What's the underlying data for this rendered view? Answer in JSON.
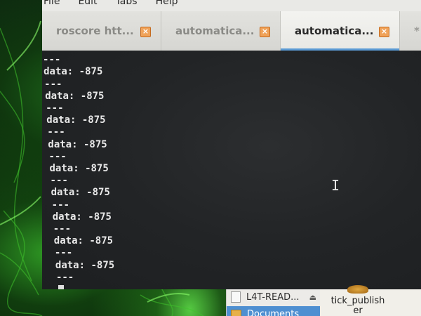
{
  "menubar": {
    "items": [
      "File",
      "Edit",
      "Tabs",
      "Help"
    ]
  },
  "tabs": [
    {
      "label": "roscore htt...",
      "active": false
    },
    {
      "label": "automatica...",
      "active": false
    },
    {
      "label": "automatica...",
      "active": true
    },
    {
      "label": "* a",
      "active": false
    }
  ],
  "terminal": {
    "lines": [
      "data: -875",
      "---",
      "data: -875",
      "---",
      "data: -875",
      "---",
      "data: -875",
      "---",
      "data: -875",
      "---",
      "data: -875",
      "---",
      "data: -875",
      "---",
      "data: -875",
      "---",
      "data: -875",
      "---",
      "data: -875",
      "---"
    ]
  },
  "file_panel": {
    "items": [
      {
        "label": "L4T-READ...",
        "icon": "document-icon",
        "eject": "⏏"
      },
      {
        "label": "Documents",
        "icon": "folder-icon",
        "selected": true
      }
    ]
  },
  "desktop": {
    "icon_label_line1": "tick_publish",
    "icon_label_line2": "er"
  },
  "colors": {
    "tab_active_accent": "#5b9bd5",
    "terminal_bg": "#222426",
    "close_icon": "#f0a35a",
    "selection": "#4e8fd1"
  }
}
